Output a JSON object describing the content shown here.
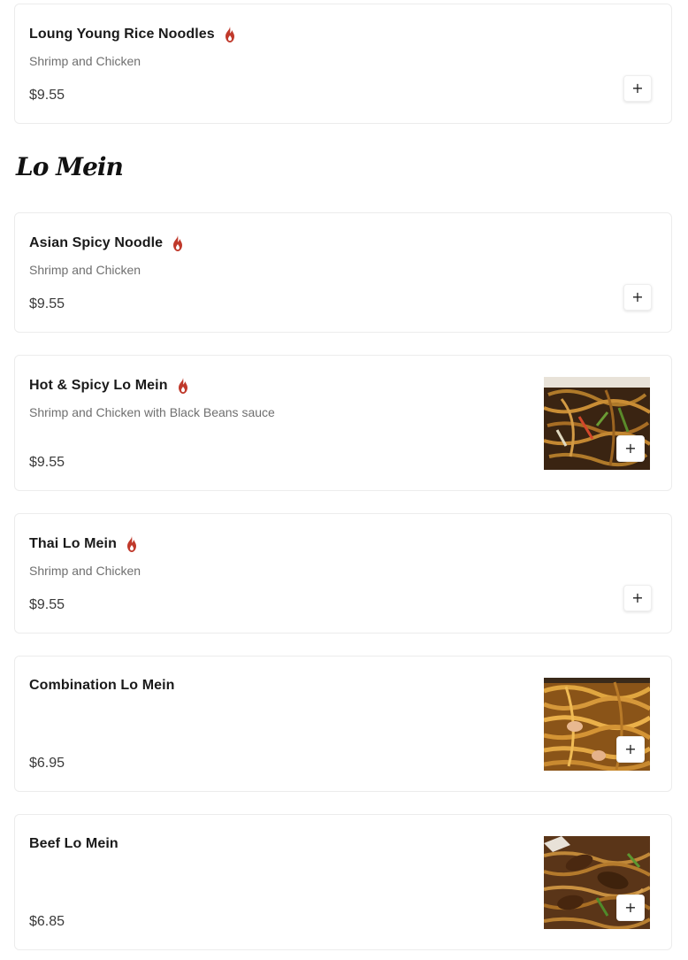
{
  "colors": {
    "spicy": "#c0392b",
    "border": "#ececec",
    "price": "#3a3a3a",
    "description": "#6f6f6f"
  },
  "icons": {
    "spicy": "fire-icon",
    "add": "plus-icon"
  },
  "top_item": {
    "name": "Loung Young Rice Noodles",
    "spicy": true,
    "description": "Shrimp and Chicken",
    "price": "$9.55",
    "add_label": "+"
  },
  "section": {
    "title": "Lo Mein"
  },
  "items": [
    {
      "name": "Asian Spicy Noodle",
      "spicy": true,
      "description": "Shrimp and Chicken",
      "price": "$9.55",
      "has_image": false,
      "add_label": "+"
    },
    {
      "name": "Hot & Spicy Lo Mein",
      "spicy": true,
      "description": "Shrimp and Chicken with Black Beans sauce",
      "price": "$9.55",
      "has_image": true,
      "add_label": "+"
    },
    {
      "name": "Thai Lo Mein",
      "spicy": true,
      "description": "Shrimp and Chicken",
      "price": "$9.55",
      "has_image": false,
      "add_label": "+"
    },
    {
      "name": "Combination Lo Mein",
      "spicy": false,
      "description": "",
      "price": "$6.95",
      "has_image": true,
      "add_label": "+"
    },
    {
      "name": "Beef Lo Mein",
      "spicy": false,
      "description": "",
      "price": "$6.85",
      "has_image": true,
      "add_label": "+"
    }
  ]
}
